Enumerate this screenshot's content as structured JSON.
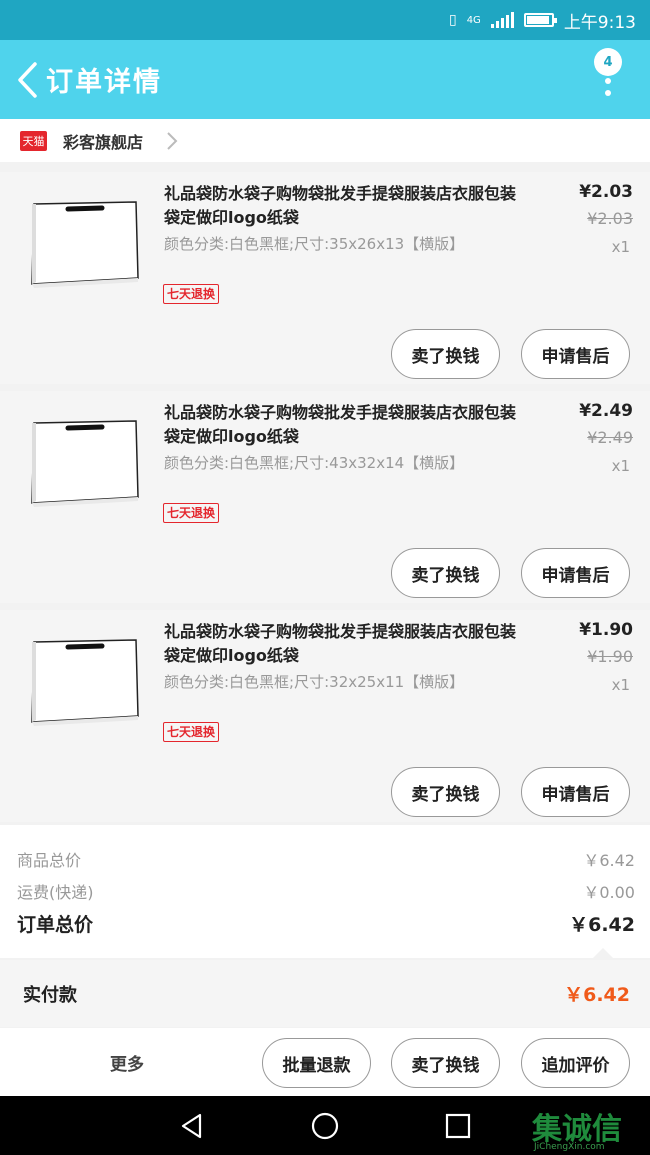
{
  "status_bar": {
    "time": "上午9:13",
    "network": "4G"
  },
  "nav": {
    "title": "订单详情",
    "badge": "4"
  },
  "shop": {
    "logo_text": "天猫",
    "name": "彩客旗舰店"
  },
  "items": [
    {
      "title": "礼品袋防水袋子购物袋批发手提袋服装店衣服包装袋定做印logo纸袋",
      "attr": "颜色分类:白色黑框;尺寸:35x26x13【横版】",
      "tag": "七天退换",
      "price": "¥2.03",
      "orig_price": "¥2.03",
      "qty": "x1",
      "btn_refund": "卖了换钱",
      "btn_service": "申请售后"
    },
    {
      "title": "礼品袋防水袋子购物袋批发手提袋服装店衣服包装袋定做印logo纸袋",
      "attr": "颜色分类:白色黑框;尺寸:43x32x14【横版】",
      "tag": "七天退换",
      "price": "¥2.49",
      "orig_price": "¥2.49",
      "qty": "x1",
      "btn_refund": "卖了换钱",
      "btn_service": "申请售后"
    },
    {
      "title": "礼品袋防水袋子购物袋批发手提袋服装店衣服包装袋定做印logo纸袋",
      "attr": "颜色分类:白色黑框;尺寸:32x25x11【横版】",
      "tag": "七天退换",
      "price": "¥1.90",
      "orig_price": "¥1.90",
      "qty": "x1",
      "btn_refund": "卖了换钱",
      "btn_service": "申请售后"
    }
  ],
  "summary": {
    "goods_label": "商品总价",
    "goods_value": "￥6.42",
    "shipping_label": "运费(快递)",
    "shipping_value": "￥0.00",
    "total_label": "订单总价",
    "total_value": "￥6.42"
  },
  "paid": {
    "label": "实付款",
    "value": "￥6.42"
  },
  "actions": {
    "more": "更多",
    "batch_refund": "批量退款",
    "sell": "卖了换钱",
    "add_review": "追加评价"
  },
  "watermark": {
    "big": "集诚信",
    "small": "JiChengXin.com"
  },
  "colors": {
    "nav": "#4fd3ec",
    "status": "#1fa6c2",
    "accent": "#f05a1a",
    "tag": "#e4262d"
  }
}
